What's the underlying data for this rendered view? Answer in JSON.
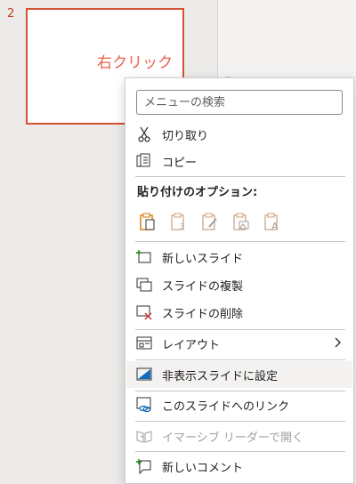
{
  "thumbnail": {
    "slide_number": "2",
    "text": "右クリック"
  },
  "menu": {
    "search_placeholder": "メニューの検索",
    "cut": "切り取り",
    "copy": "コピー",
    "paste_options_heading": "貼り付けのオプション:",
    "paste_options": [
      {
        "icon": "paste-use-destination-theme-icon"
      },
      {
        "icon": "paste-keep-source-formatting-icon"
      },
      {
        "icon": "paste-embed-icon"
      },
      {
        "icon": "paste-picture-icon"
      },
      {
        "icon": "paste-text-only-icon"
      }
    ],
    "new_slide": "新しいスライド",
    "duplicate_slide": "スライドの複製",
    "delete_slide": "スライドの削除",
    "layout": "レイアウト",
    "hide_slide": "非表示スライドに設定",
    "link_to_slide": "このスライドへのリンク",
    "immersive_reader": "イマーシブ リーダーで開く",
    "new_comment": "新しいコメント"
  },
  "colors": {
    "accent_red": "#d35230",
    "paste_orange": "#d47500",
    "hover_bg": "#f3f2f1"
  }
}
